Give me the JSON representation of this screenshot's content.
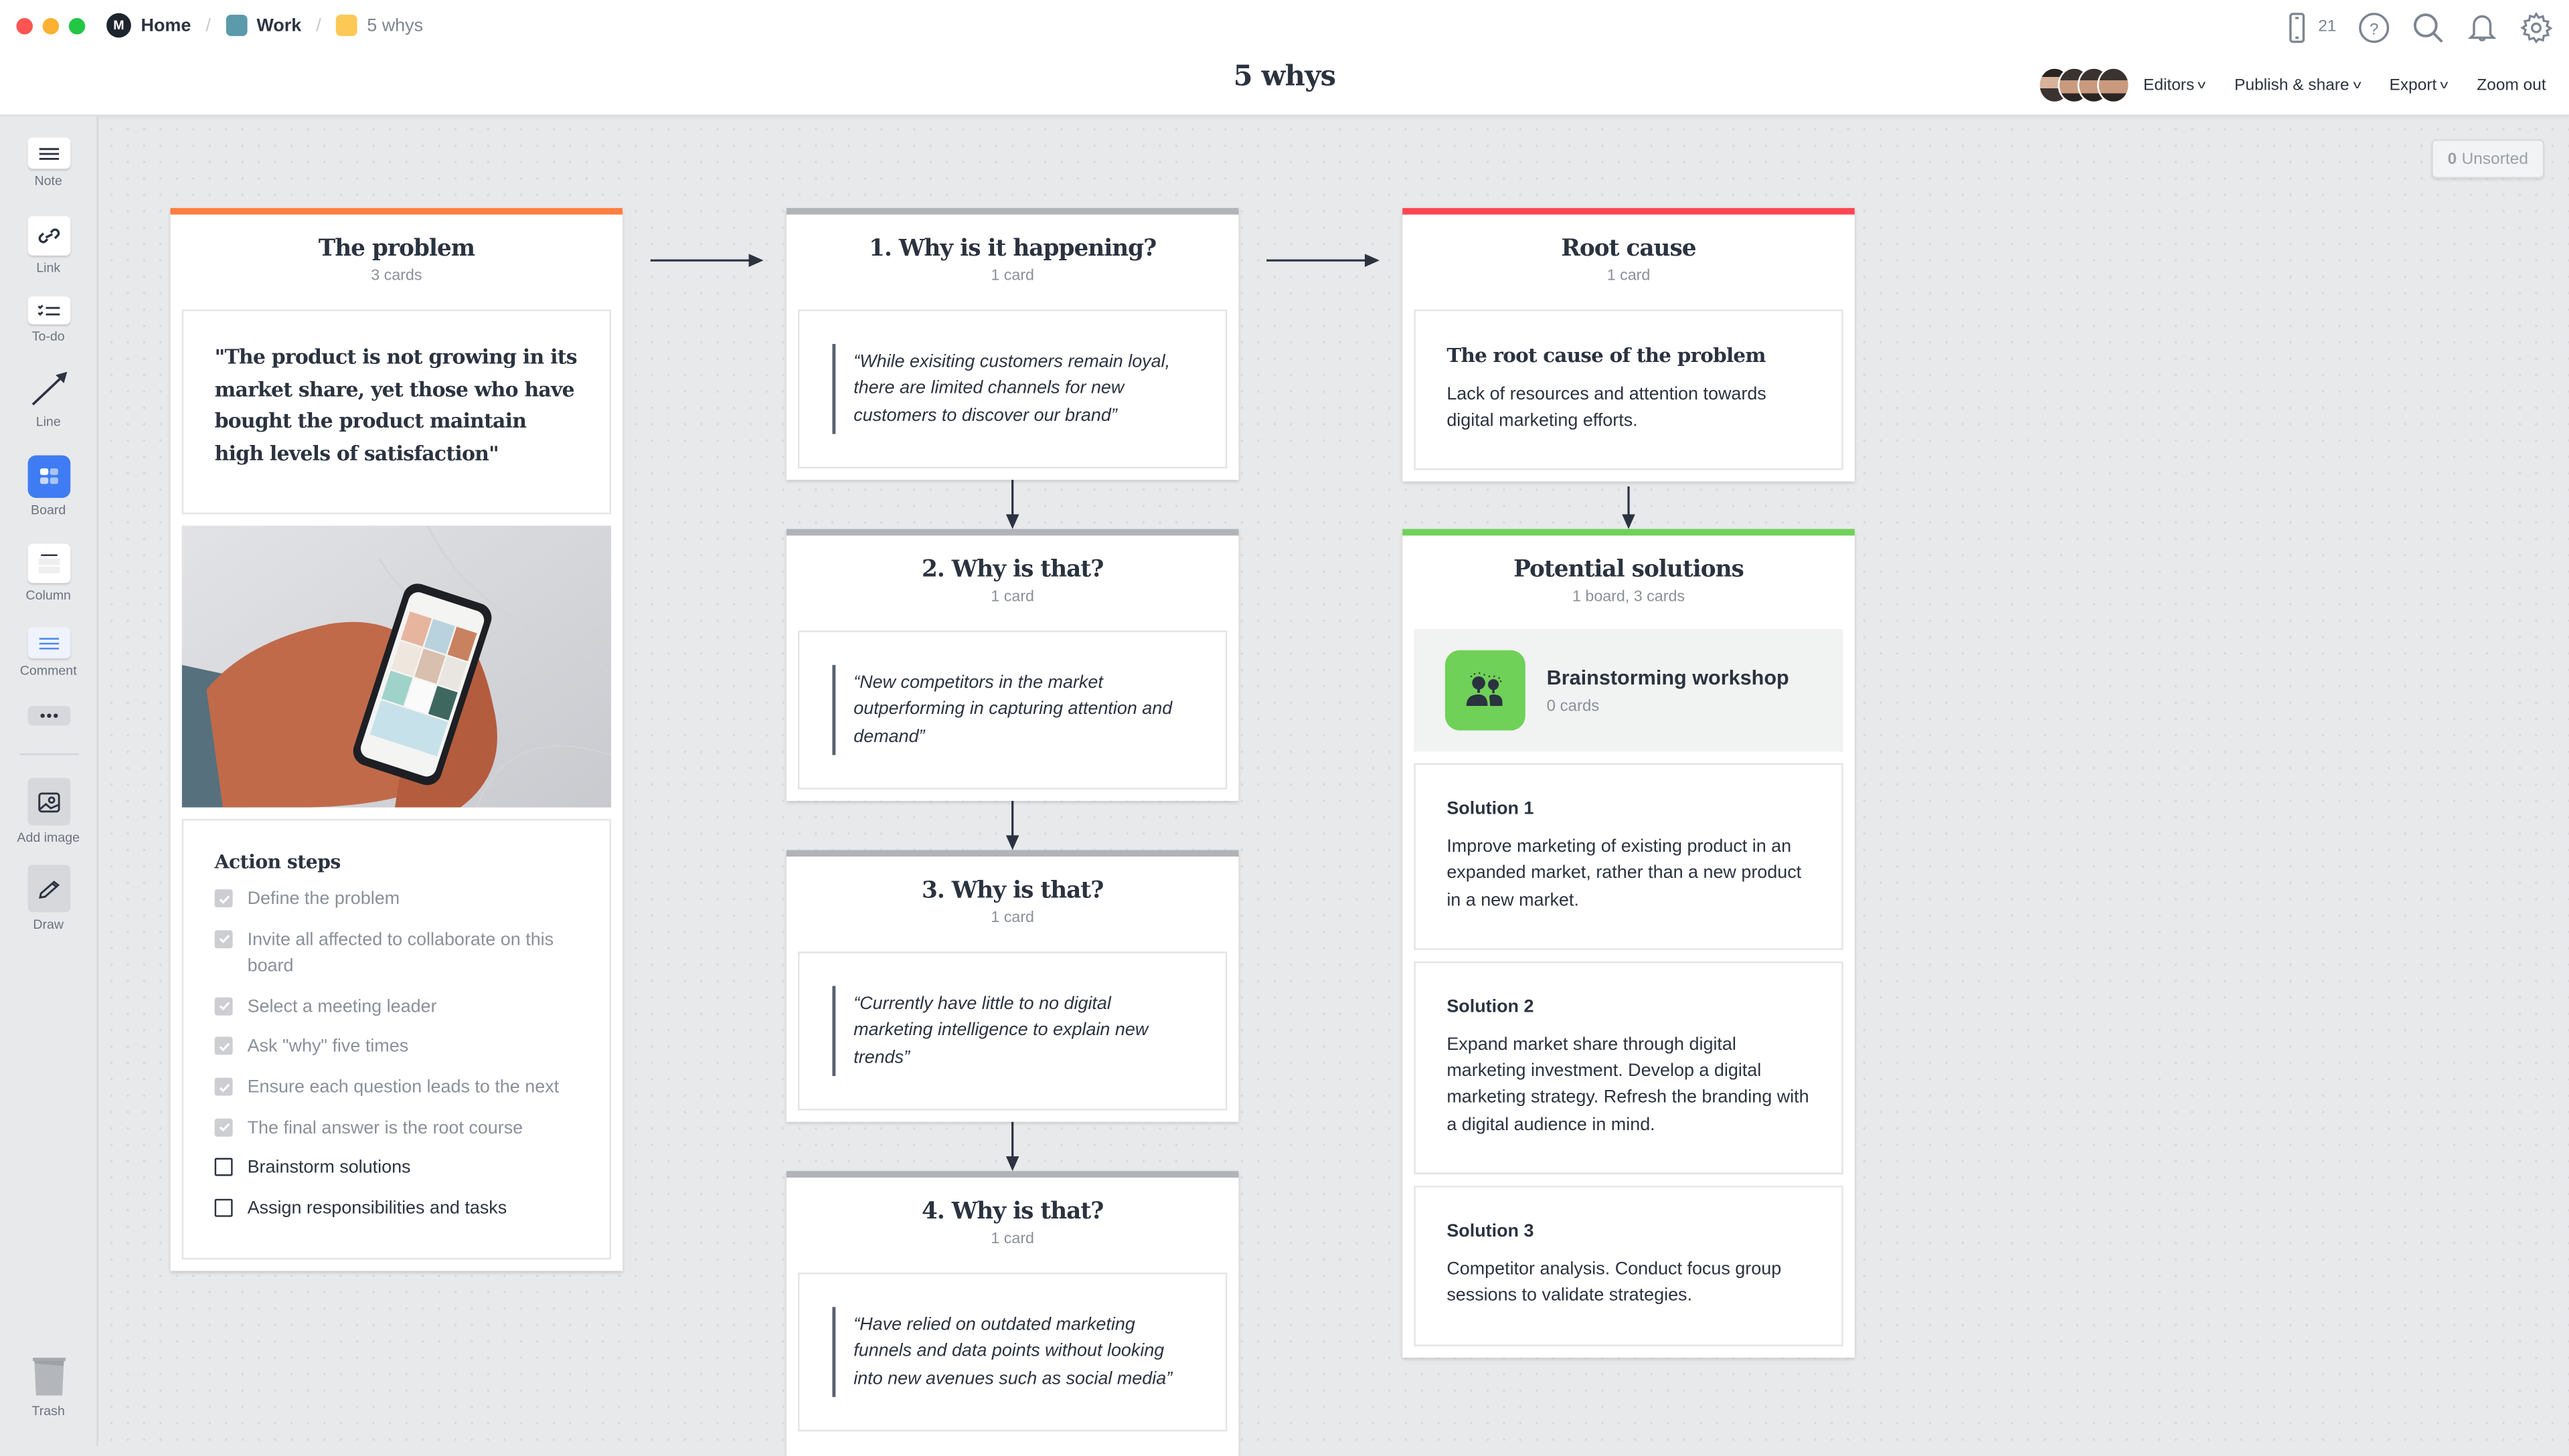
{
  "window": {
    "breadcrumbs": [
      {
        "label": "Home",
        "icon": "milanote-logo"
      },
      {
        "label": "Work",
        "icon": "board-square",
        "color": "#5b9aaa"
      },
      {
        "label": "5 whys",
        "icon": "board-square",
        "color": "#fdc855"
      }
    ],
    "title": "5 whys",
    "traffic_lights": [
      "#fe5552",
      "#fdb132",
      "#23c645"
    ]
  },
  "top_icons": {
    "device_count": "21",
    "icons": [
      "phone-icon",
      "help-icon",
      "search-icon",
      "bell-icon",
      "gear-icon"
    ]
  },
  "header_actions": {
    "editors": "Editors",
    "publish": "Publish & share",
    "export": "Export",
    "zoom_out": "Zoom out"
  },
  "sidebar": {
    "tools": [
      {
        "label": "Note",
        "icon": "note-icon"
      },
      {
        "label": "Link",
        "icon": "link-icon"
      },
      {
        "label": "To-do",
        "icon": "todo-icon"
      },
      {
        "label": "Line",
        "icon": "line-icon"
      },
      {
        "label": "Board",
        "icon": "board-icon"
      },
      {
        "label": "Column",
        "icon": "column-icon"
      },
      {
        "label": "Comment",
        "icon": "comment-icon"
      },
      {
        "label": "",
        "icon": "more-icon"
      },
      {
        "label": "Add image",
        "icon": "image-icon"
      },
      {
        "label": "Draw",
        "icon": "pencil-icon"
      },
      {
        "label": "Trash",
        "icon": "trash-icon"
      }
    ]
  },
  "unsorted": {
    "count": "0",
    "label": "Unsorted"
  },
  "colors": {
    "problem": "#ff7d40",
    "why": "#b0b3b8",
    "root": "#ff4652",
    "solutions": "#6fd157",
    "board_accent": "#3f7cf3"
  },
  "problem": {
    "title": "The problem",
    "count": "3 cards",
    "quote": "\"The product is not growing in its market share, yet those who have bought the product maintain high levels of satisfaction\"",
    "image_alt": "Hands holding a smartphone showing a photo grid over a marble surface",
    "actions_title": "Action steps",
    "todos": [
      {
        "text": "Define the problem",
        "done": true
      },
      {
        "text": "Invite all affected to collaborate on this board",
        "done": true
      },
      {
        "text": "Select a meeting leader",
        "done": true
      },
      {
        "text": "Ask \"why\" five times",
        "done": true
      },
      {
        "text": "Ensure each question leads to the next",
        "done": true
      },
      {
        "text": "The final answer is the root course",
        "done": true
      },
      {
        "text": "Brainstorm solutions",
        "done": false
      },
      {
        "text": "Assign responsibilities and tasks",
        "done": false
      }
    ]
  },
  "whys": [
    {
      "title": "1. Why is it happening?",
      "count": "1 card",
      "quote": "“While exisiting customers remain loyal, there are limited channels for new customers to discover our brand”"
    },
    {
      "title": "2. Why is that?",
      "count": "1 card",
      "quote": "“New competitors in the market outperforming in capturing attention and demand”"
    },
    {
      "title": "3. Why is that?",
      "count": "1 card",
      "quote": "“Currently have little to no digital marketing intelligence to explain new trends”"
    },
    {
      "title": "4. Why is that?",
      "count": "1 card",
      "quote": "“Have relied on outdated marketing funnels and data points without looking into new avenues such as social media”"
    }
  ],
  "root": {
    "title": "Root cause",
    "count": "1 card",
    "card_title": "The root cause of the problem",
    "card_body": "Lack of resources and attention towards digital marketing efforts."
  },
  "solutions": {
    "title": "Potential solutions",
    "count": "1 board, 3 cards",
    "board": {
      "name": "Brainstorming workshop",
      "count": "0 cards"
    },
    "items": [
      {
        "title": "Solution 1",
        "body": "Improve marketing of existing product in an expanded market, rather than a new product in a new market."
      },
      {
        "title": "Solution 2",
        "body": "Expand market share through digital marketing investment. Develop a digital marketing strategy. Refresh the branding with a digital audience in mind."
      },
      {
        "title": "Solution 3",
        "body": "Competitor analysis. Conduct focus group sessions to validate strategies."
      }
    ]
  }
}
